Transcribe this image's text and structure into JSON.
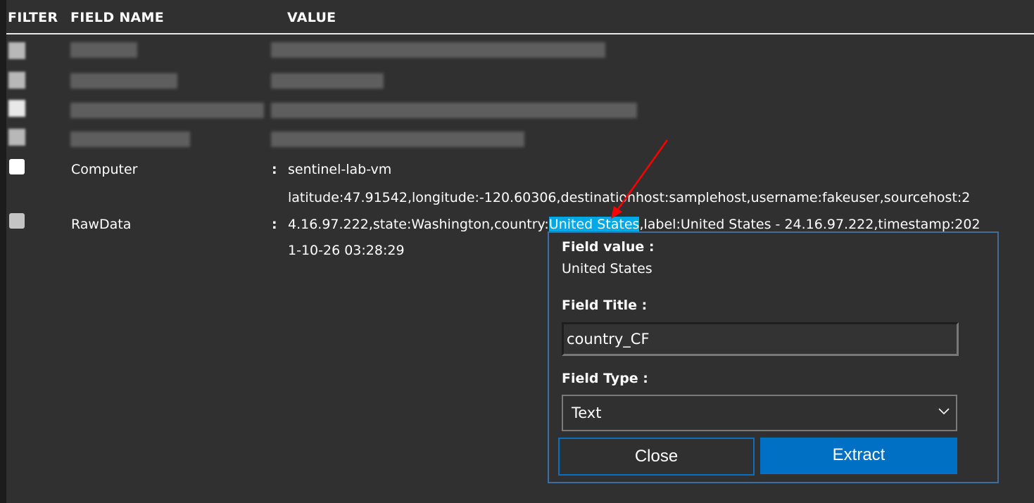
{
  "header": {
    "filter": "FILTER",
    "field_name": "FIELD NAME",
    "value": "VALUE"
  },
  "rows": [
    {
      "field": "Computer",
      "separator": ":",
      "value": "sentinel-lab-vm"
    },
    {
      "field": "RawData",
      "separator": ":",
      "value_line1": "latitude:47.91542,longitude:-120.60306,destinationhost:samplehost,username:fakeuser,sourcehost:2",
      "value_line2_before": "4.16.97.222,state:Washington,country:",
      "value_line2_selected": "United States",
      "value_line2_after": ",label:United States - 24.16.97.222,timestamp:202",
      "value_line3": "1-10-26 03:28:29"
    }
  ],
  "popup": {
    "field_value_label": "Field value :",
    "field_value": "United States",
    "field_title_label": "Field Title :",
    "field_title_value": "country_CF",
    "field_type_label": "Field Type :",
    "field_type_selected": "Text",
    "close_label": "Close",
    "extract_label": "Extract"
  },
  "colors": {
    "selection": "#00a8e8",
    "accent": "#0070c4",
    "popup_border": "#3f6d9e",
    "arrow": "#ff0000"
  }
}
